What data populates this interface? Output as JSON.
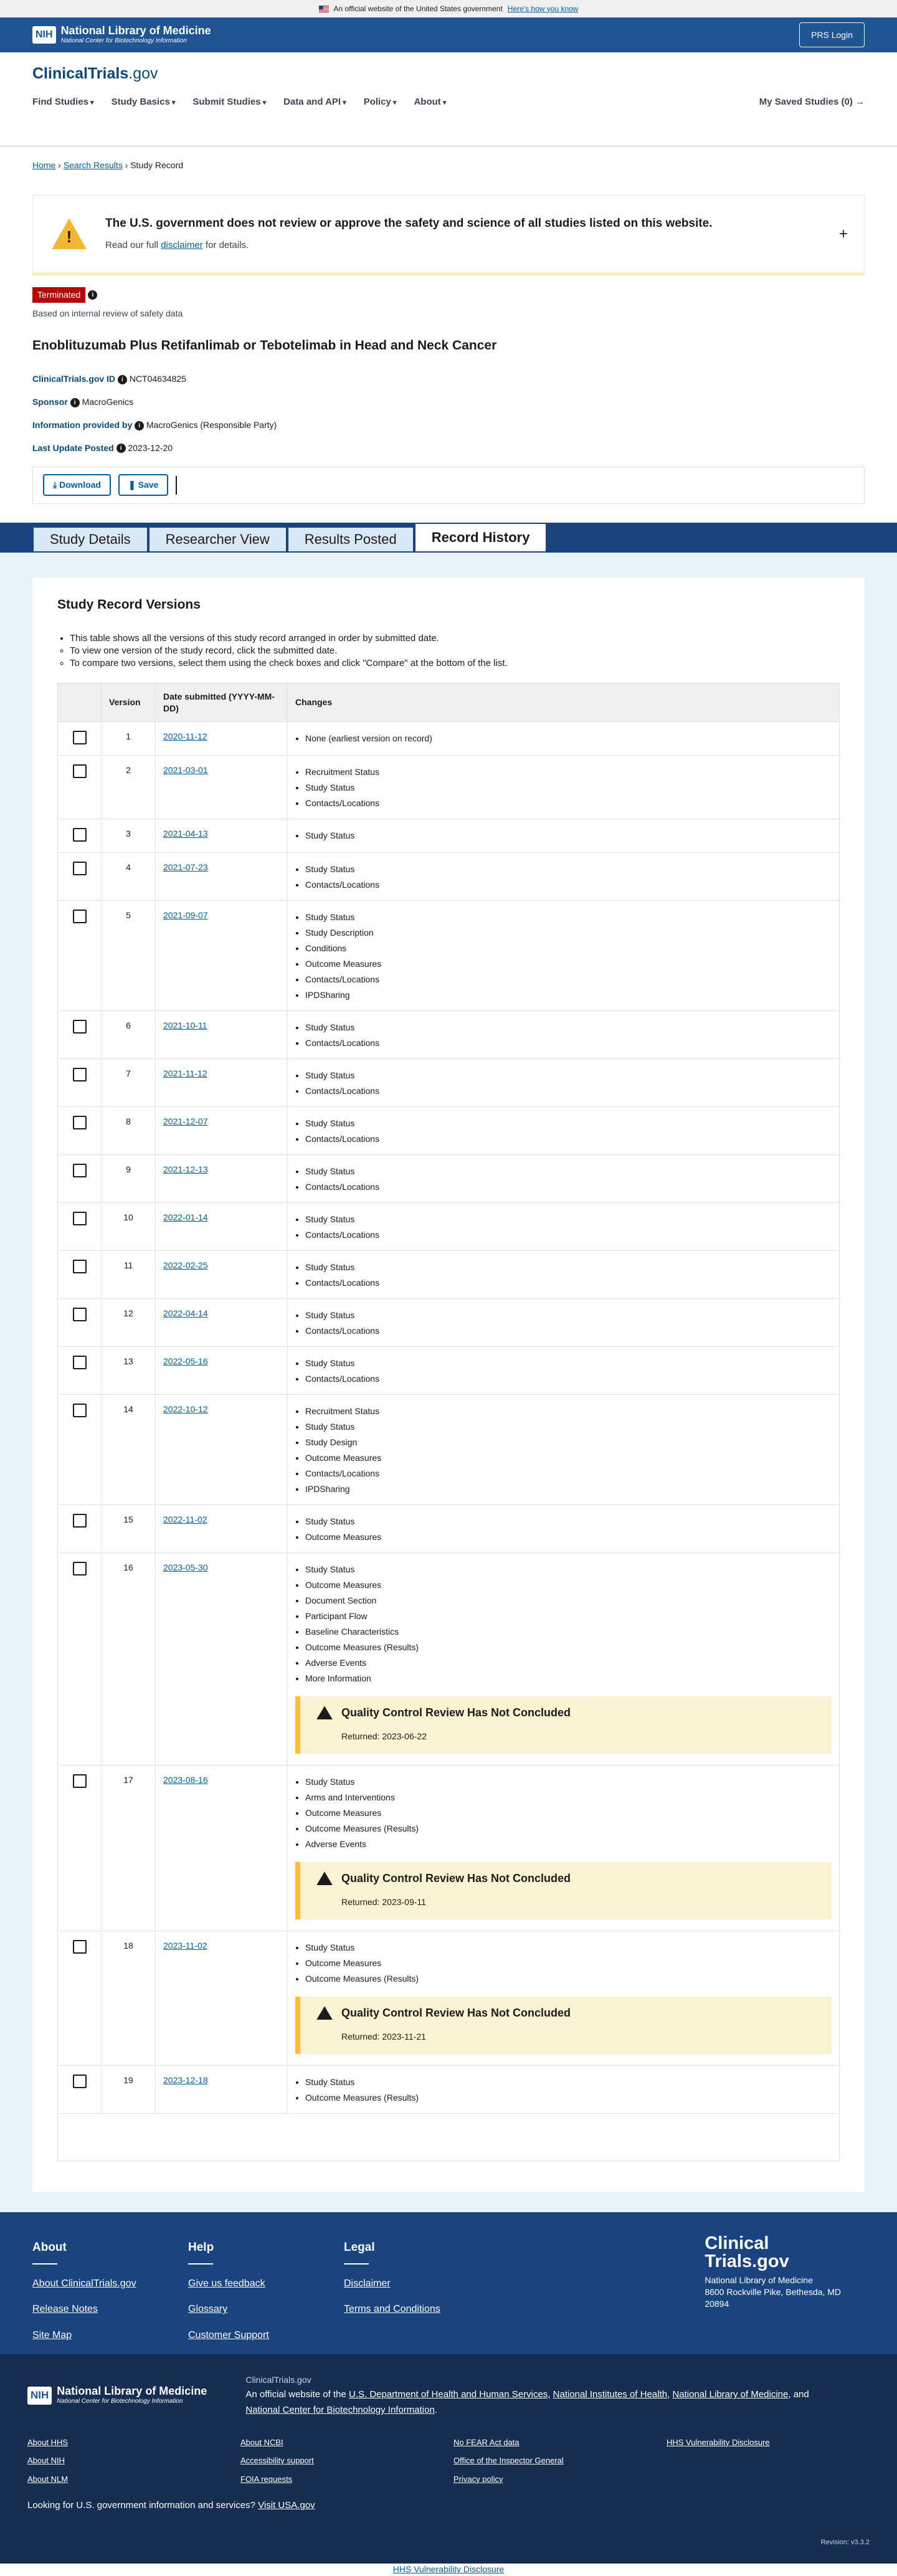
{
  "gov_banner": {
    "text": "An official website of the United States government",
    "link": "Here's how you know"
  },
  "nih_header": {
    "mark": "NIH",
    "title": "National Library of Medicine",
    "subtitle": "National Center for Biotechnology Information",
    "login": "PRS Login"
  },
  "ct_header": {
    "logo_a": "ClinicalTrials",
    "logo_b": ".gov",
    "nav": [
      "Find Studies",
      "Study Basics",
      "Submit Studies",
      "Data and API",
      "Policy",
      "About"
    ],
    "saved": "My Saved Studies (0) →"
  },
  "breadcrumb": {
    "home": "Home",
    "search": "Search Results",
    "current": "Study Record"
  },
  "disclaimer": {
    "title": "The U.S. government does not review or approve the safety and science of all studies listed on this website.",
    "text_pre": "Read our full ",
    "link": "disclaimer",
    "text_post": " for details.",
    "icon": "!"
  },
  "record": {
    "status": "Terminated",
    "status_note": "Based on internal review of safety data",
    "title": "Enoblituzumab Plus Retifanlimab or Tebotelimab in Head and Neck Cancer",
    "id_label": "ClinicalTrials.gov ID",
    "id": "NCT04634825",
    "sponsor_label": "Sponsor",
    "sponsor": "MacroGenics",
    "provided_label": "Information provided by",
    "provided": "MacroGenics (Responsible Party)",
    "updated_label": "Last Update Posted",
    "updated": "2023-12-20"
  },
  "actions": {
    "download": "Download",
    "save": "Save"
  },
  "tabs": [
    "Study Details",
    "Researcher View",
    "Results Posted",
    "Record History"
  ],
  "versions_section": {
    "heading": "Study Record Versions",
    "intro": "This table shows all the versions of this study record arranged in order by submitted date.",
    "intro_sub1": "To view one version of the study record, click the submitted date.",
    "intro_sub2": "To compare two versions, select them using the check boxes and click \"Compare\" at the bottom of the list.",
    "col_version": "Version",
    "col_date": "Date submitted (YYYY-MM-DD)",
    "col_changes": "Changes",
    "qc_title": "Quality Control Review Has Not Concluded",
    "rows": [
      {
        "version": "1",
        "date": "2020-11-12",
        "changes": [
          "None (earliest version on record)"
        ]
      },
      {
        "version": "2",
        "date": "2021-03-01",
        "changes": [
          "Recruitment Status",
          "Study Status",
          "Contacts/Locations"
        ]
      },
      {
        "version": "3",
        "date": "2021-04-13",
        "changes": [
          "Study Status"
        ]
      },
      {
        "version": "4",
        "date": "2021-07-23",
        "changes": [
          "Study Status",
          "Contacts/Locations"
        ]
      },
      {
        "version": "5",
        "date": "2021-09-07",
        "changes": [
          "Study Status",
          "Study Description",
          "Conditions",
          "Outcome Measures",
          "Contacts/Locations",
          "IPDSharing"
        ]
      },
      {
        "version": "6",
        "date": "2021-10-11",
        "changes": [
          "Study Status",
          "Contacts/Locations"
        ]
      },
      {
        "version": "7",
        "date": "2021-11-12",
        "changes": [
          "Study Status",
          "Contacts/Locations"
        ]
      },
      {
        "version": "8",
        "date": "2021-12-07",
        "changes": [
          "Study Status",
          "Contacts/Locations"
        ]
      },
      {
        "version": "9",
        "date": "2021-12-13",
        "changes": [
          "Study Status",
          "Contacts/Locations"
        ]
      },
      {
        "version": "10",
        "date": "2022-01-14",
        "changes": [
          "Study Status",
          "Contacts/Locations"
        ]
      },
      {
        "version": "11",
        "date": "2022-02-25",
        "changes": [
          "Study Status",
          "Contacts/Locations"
        ]
      },
      {
        "version": "12",
        "date": "2022-04-14",
        "changes": [
          "Study Status",
          "Contacts/Locations"
        ]
      },
      {
        "version": "13",
        "date": "2022-05-16",
        "changes": [
          "Study Status",
          "Contacts/Locations"
        ]
      },
      {
        "version": "14",
        "date": "2022-10-12",
        "changes": [
          "Recruitment Status",
          "Study Status",
          "Study Design",
          "Outcome Measures",
          "Contacts/Locations",
          "IPDSharing"
        ]
      },
      {
        "version": "15",
        "date": "2022-11-02",
        "changes": [
          "Study Status",
          "Outcome Measures"
        ]
      },
      {
        "version": "16",
        "date": "2023-05-30",
        "changes": [
          "Study Status",
          "Outcome Measures",
          "Document Section",
          "Participant Flow",
          "Baseline Characteristics",
          "Outcome Measures (Results)",
          "Adverse Events",
          "More Information"
        ],
        "qc_returned": "Returned: 2023-06-22"
      },
      {
        "version": "17",
        "date": "2023-08-16",
        "changes": [
          "Study Status",
          "Arms and Interventions",
          "Outcome Measures",
          "Outcome Measures (Results)",
          "Adverse Events"
        ],
        "qc_returned": "Returned: 2023-09-11"
      },
      {
        "version": "18",
        "date": "2023-11-02",
        "changes": [
          "Study Status",
          "Outcome Measures",
          "Outcome Measures (Results)"
        ],
        "qc_returned": "Returned: 2023-11-21"
      },
      {
        "version": "19",
        "date": "2023-12-18",
        "changes": [
          "Study Status",
          "Outcome Measures (Results)"
        ]
      }
    ]
  },
  "footer": {
    "about_h": "About",
    "about_links": [
      "About ClinicalTrials.gov",
      "Release Notes",
      "Site Map"
    ],
    "help_h": "Help",
    "help_links": [
      "Give us feedback",
      "Glossary",
      "Customer Support"
    ],
    "legal_h": "Legal",
    "legal_links": [
      "Disclaimer",
      "Terms and Conditions"
    ],
    "logo_line1": "Clinical",
    "logo_line2": "Trials.gov",
    "address1": "National Library of Medicine",
    "address2": "8600 Rockville Pike, Bethesda, MD",
    "address3": "20894"
  },
  "footer_bottom": {
    "ctg": "ClinicalTrials.gov",
    "official_pre": "An official website of the ",
    "hhs": "U.S. Department of Health and Human Services",
    "nih": "National Institutes of Health",
    "nlm": "National Library of Medicine",
    "and": ", and ",
    "ncbi": "National Center for Biotechnology Information",
    "links": [
      "About HHS",
      "About NCBI",
      "No FEAR Act data",
      "HHS Vulnerability Disclosure",
      "About NIH",
      "Accessibility support",
      "Office of the Inspector General",
      "About NLM",
      "FOIA requests",
      "Privacy policy"
    ],
    "usa_pre": "Looking for U.S. government information and services?",
    "usa_link": "Visit USA.gov",
    "revision": "Revision: v3.3.2",
    "bottom_link": "HHS Vulnerability Disclosure"
  }
}
